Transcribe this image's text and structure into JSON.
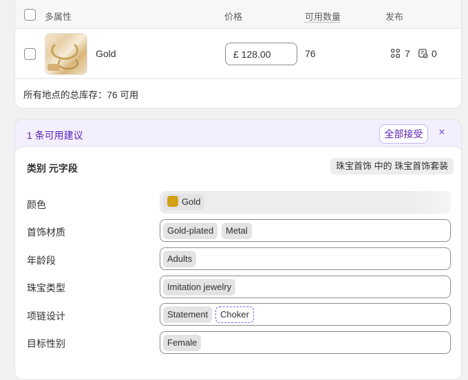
{
  "table": {
    "headers": {
      "attributes": "多属性",
      "price": "价格",
      "available": "可用数量",
      "publish": "发布"
    },
    "row": {
      "name": "Gold",
      "price": "£ 128.00",
      "available": "76",
      "channels_count": "7",
      "catalogs_count": "0"
    },
    "total_inventory": "所有地点的总库存：76 可用"
  },
  "suggestions": {
    "count_label": "1 条可用建议",
    "accept_all": "全部接受",
    "close": "×",
    "category_label": "类别 元字段",
    "category_value": "珠宝首饰 中的 珠宝首饰套装",
    "fields": [
      {
        "label": "颜色",
        "tags": [
          "Gold"
        ],
        "swatch": "#d4a017"
      },
      {
        "label": "首饰材质",
        "tags": [
          "Gold-plated",
          "Metal"
        ]
      },
      {
        "label": "年龄段",
        "tags": [
          "Adults"
        ]
      },
      {
        "label": "珠宝类型",
        "tags": [
          "Imitation jewelry"
        ]
      },
      {
        "label": "项链设计",
        "tags": [
          "Statement",
          "Choker"
        ]
      },
      {
        "label": "目标性别",
        "tags": [
          "Female"
        ]
      }
    ]
  },
  "colors": {
    "accent": "#5b21b6",
    "suggestion_bg": "#f3efff"
  }
}
